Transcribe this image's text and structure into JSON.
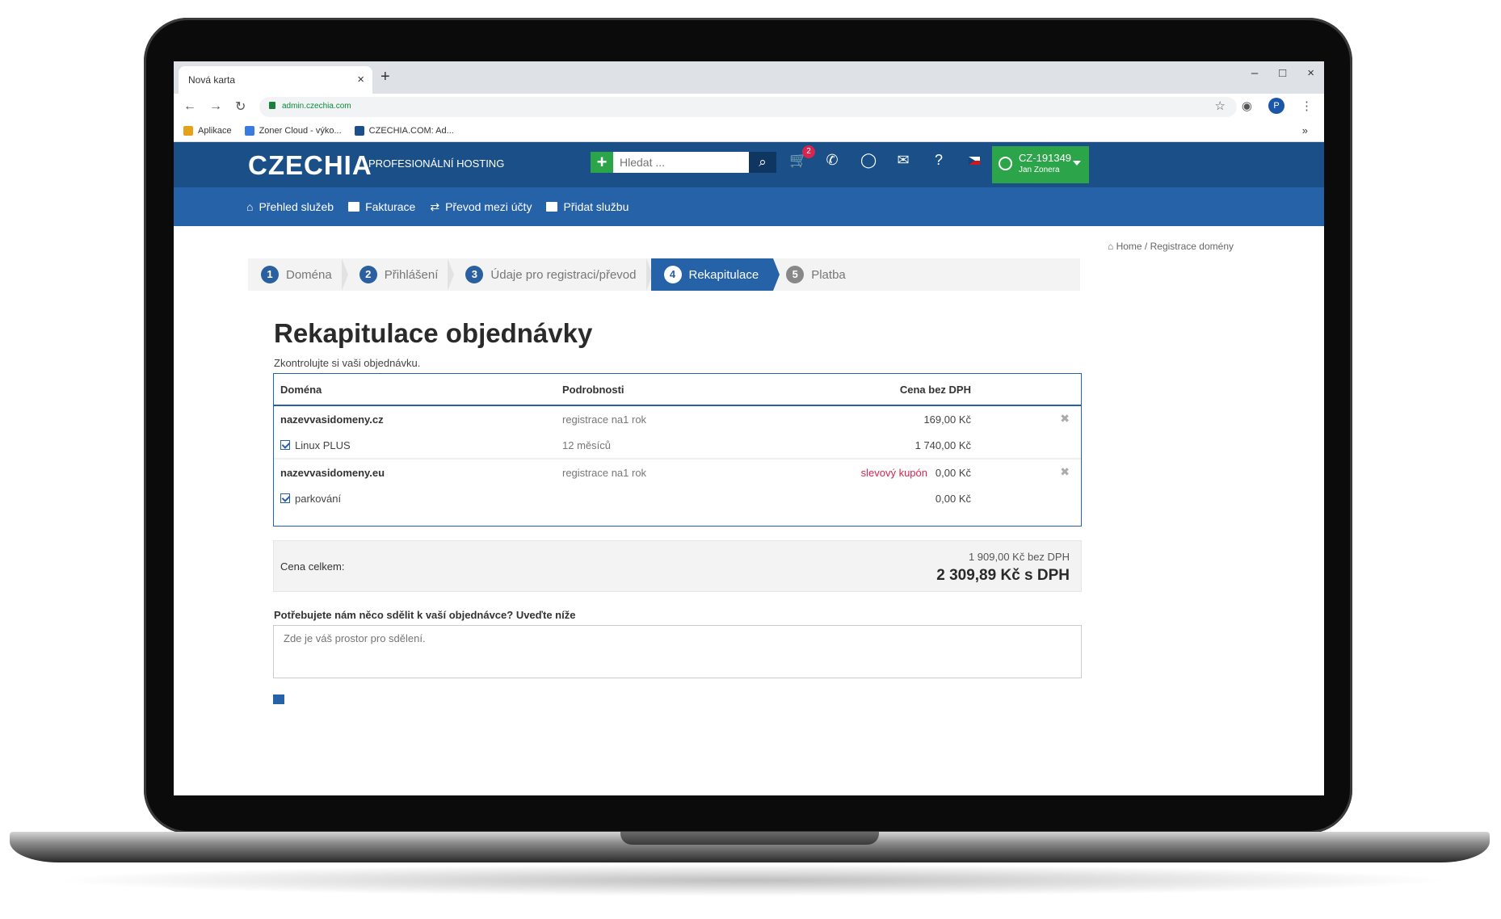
{
  "browser": {
    "tab_title": "Nová karta",
    "tab_close": "×",
    "new_tab": "+",
    "window_buttons": [
      "–",
      "□",
      "×"
    ],
    "url": "admin.czechia.com",
    "bookmarks": [
      {
        "label": "Aplikace",
        "color": "#e6a11b"
      },
      {
        "label": "Zoner Cloud - výko...",
        "color": "#3b7be0"
      },
      {
        "label": "CZECHIA.COM: Ad...",
        "color": "#1b4f87"
      }
    ],
    "profile_initial": "P",
    "bookmarks_more": "»"
  },
  "header": {
    "logo": "CZECHIA",
    "tagline": "PROFESIONÁLNÍ HOSTING",
    "search_placeholder": "Hledat ...",
    "cart_count": "2",
    "account_id": "CZ-191349",
    "account_name": "Jan Zonera"
  },
  "subnav": [
    "Přehled služeb",
    "Fakturace",
    "Převod mezi účty",
    "Přidat službu"
  ],
  "breadcrumb": {
    "home": "Home",
    "sep": "/",
    "current": "Registrace domény"
  },
  "steps": [
    {
      "num": "1",
      "label": "Doména"
    },
    {
      "num": "2",
      "label": "Přihlášení"
    },
    {
      "num": "3",
      "label": "Údaje pro registraci/převod"
    },
    {
      "num": "4",
      "label": "Rekapitulace"
    },
    {
      "num": "5",
      "label": "Platba"
    }
  ],
  "page": {
    "title": "Rekapitulace objednávky",
    "subtitle": "Zkontrolujte si vaši objednávku."
  },
  "table": {
    "headers": {
      "domain": "Doména",
      "details": "Podrobnosti",
      "price": "Cena bez DPH"
    },
    "rows": [
      {
        "domain": "nazevvasidomeny.cz",
        "details": "registrace na1 rok",
        "price": "169,00 Kč"
      },
      {
        "service": "Linux PLUS",
        "details": "12 měsíců",
        "price": "1 740,00 Kč"
      },
      {
        "domain": "nazevvasidomeny.eu",
        "details": "registrace na1 rok",
        "coupon": "slevový kupón",
        "price": "0,00 Kč"
      },
      {
        "service": "parkování",
        "price": "0,00 Kč"
      }
    ]
  },
  "total": {
    "label": "Cena celkem:",
    "net": "1 909,00 Kč bez DPH",
    "gross": "2 309,89 Kč s DPH"
  },
  "note": {
    "label": "Potřebujete nám něco sdělit k vaší objednávce? Uveďte níže",
    "placeholder": "Zde je váš prostor pro sdělení."
  }
}
